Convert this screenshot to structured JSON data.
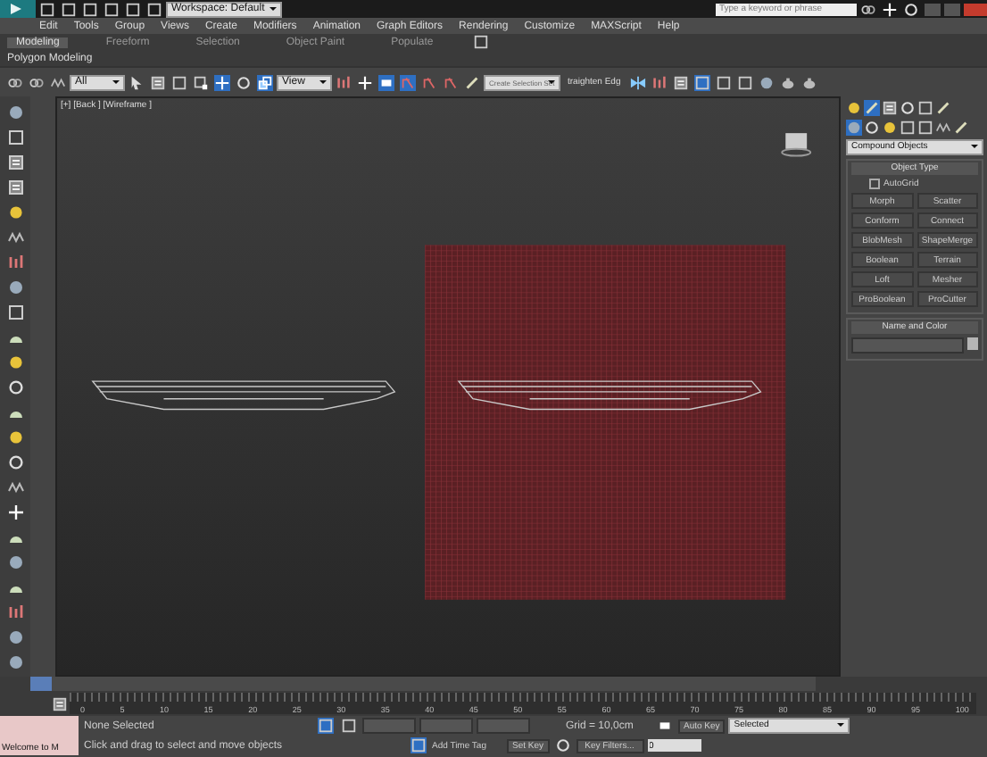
{
  "title_bar": {
    "workspace": "Workspace: Default",
    "search": {
      "placeholder": "Type a keyword or phrase"
    }
  },
  "menu": [
    "Edit",
    "Tools",
    "Group",
    "Views",
    "Create",
    "Modifiers",
    "Animation",
    "Graph Editors",
    "Rendering",
    "Customize",
    "MAXScript",
    "Help"
  ],
  "ribbon_tabs": [
    {
      "label": "Modeling",
      "selected": true
    },
    {
      "label": "Freeform",
      "selected": false
    },
    {
      "label": "Selection",
      "selected": false
    },
    {
      "label": "Object Paint",
      "selected": false
    },
    {
      "label": "Populate",
      "selected": false
    }
  ],
  "ribbon_panel": "Polygon Modeling",
  "toolbar": {
    "filter": "All",
    "coordinate_system": "View",
    "selection_set": "Create Selection Set",
    "straighten": "traighten Edg"
  },
  "viewport": {
    "label": "[+] [Back ] [Wireframe ]"
  },
  "command_panel": {
    "category": "Compound Objects",
    "object_type": {
      "title": "Object Type",
      "autogrid": {
        "label": "AutoGrid",
        "checked": false
      },
      "buttons": [
        {
          "label": "Morph",
          "selected": false
        },
        {
          "label": "Scatter",
          "selected": false
        },
        {
          "label": "Conform",
          "selected": false
        },
        {
          "label": "Connect",
          "selected": false
        },
        {
          "label": "BlobMesh",
          "selected": false
        },
        {
          "label": "ShapeMerge",
          "selected": false
        },
        {
          "label": "Boolean",
          "selected": false
        },
        {
          "label": "Terrain",
          "selected": false
        },
        {
          "label": "Loft",
          "selected": false
        },
        {
          "label": "Mesher",
          "selected": false
        },
        {
          "label": "ProBoolean",
          "selected": false
        },
        {
          "label": "ProCutter",
          "selected": false
        }
      ]
    },
    "name_and_color": {
      "title": "Name and Color"
    }
  },
  "time_slider": {
    "level": 0
  },
  "track_ticks": [
    "0",
    "5",
    "10",
    "15",
    "20",
    "25",
    "30",
    "35",
    "40",
    "45",
    "50",
    "55",
    "60",
    "65",
    "70",
    "75",
    "80",
    "85",
    "90",
    "95",
    "100"
  ],
  "status": {
    "maxscript": "Welcome to M",
    "selection": "None Selected",
    "prompt": "Click and drag to select and move objects",
    "grid": "Grid = 10,0cm",
    "auto_key": "Auto Key",
    "key_mode": "Selected",
    "set_key": "Set Key",
    "key_filters": "Key Filters...",
    "add_time_tag": "Add Time Tag",
    "frame": "0"
  }
}
